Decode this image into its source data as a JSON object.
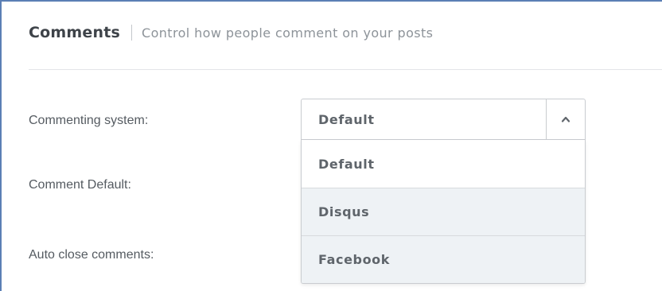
{
  "section": {
    "title": "Comments",
    "subtitle": "Control how people comment on your posts"
  },
  "fields": {
    "commenting_system_label": "Commenting system:",
    "comment_default_label": "Comment Default:",
    "auto_close_label": "Auto close comments:"
  },
  "commenting_system_select": {
    "selected": "Default",
    "expanded": true,
    "toggle_icon": "chevron-up-icon",
    "options": [
      {
        "label": "Default"
      },
      {
        "label": "Disqus"
      },
      {
        "label": "Facebook"
      }
    ]
  },
  "colors": {
    "frame_border": "#5b7fb5",
    "option_highlight": "#eef2f5"
  }
}
